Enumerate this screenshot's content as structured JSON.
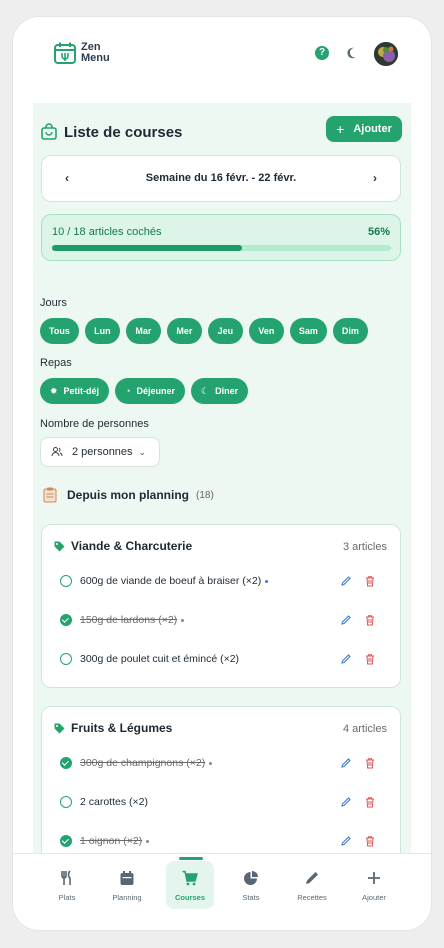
{
  "app": {
    "logo_line1": "Zen",
    "logo_line2": "Menu",
    "help_label": "?"
  },
  "header": {
    "title": "Liste de courses",
    "add_button": "Ajouter",
    "add_symbol": "+"
  },
  "week": {
    "label": "Semaine du 16 févr. - 22 févr.",
    "prev": "‹",
    "next": "›"
  },
  "progress": {
    "label": "10 / 18 articles cochés",
    "percent_label": "56%",
    "fraction": 0.56
  },
  "days": {
    "label": "Jours",
    "items": [
      "Tous",
      "Lun",
      "Mar",
      "Mer",
      "Jeu",
      "Ven",
      "Sam",
      "Dim"
    ]
  },
  "meals": {
    "label": "Repas",
    "items": [
      {
        "label": "Petit-déj",
        "icon": "sun-icon"
      },
      {
        "label": "Déjeuner",
        "icon": "clock-icon"
      },
      {
        "label": "Dîner",
        "icon": "moon-icon"
      }
    ]
  },
  "persons": {
    "label": "Nombre de personnes",
    "value": "2 personnes"
  },
  "planning": {
    "title": "Depuis mon planning",
    "count": "(18)"
  },
  "categories": [
    {
      "title": "Viande & Charcuterie",
      "count": "3 articles",
      "items": [
        {
          "text": "600g de viande de boeuf à braiser (×2)",
          "checked": false,
          "dot": "blue"
        },
        {
          "text": "150g de lardons (×2)",
          "checked": true,
          "dot": "grey"
        },
        {
          "text": "300g de poulet cuit et émincé (×2)",
          "checked": false,
          "dot": ""
        }
      ]
    },
    {
      "title": "Fruits & Légumes",
      "count": "4 articles",
      "items": [
        {
          "text": "300g de champignons (×2)",
          "checked": true,
          "dot": "grey"
        },
        {
          "text": "2 carottes (×2)",
          "checked": false,
          "dot": ""
        },
        {
          "text": "1 oignon (×2)",
          "checked": true,
          "dot": "grey"
        }
      ]
    }
  ],
  "nav": [
    {
      "label": "Plats",
      "icon": "utensils-icon",
      "active": false
    },
    {
      "label": "Planning",
      "icon": "calendar-icon",
      "active": false
    },
    {
      "label": "Courses",
      "icon": "cart-icon",
      "active": true
    },
    {
      "label": "Stats",
      "icon": "pie-chart-icon",
      "active": false
    },
    {
      "label": "Recettes",
      "icon": "pencil-icon",
      "active": false
    },
    {
      "label": "Ajouter",
      "icon": "plus-icon",
      "active": false
    }
  ],
  "colors": {
    "accent": "#24a36f",
    "background": "#eef8f2",
    "delete": "#e05252",
    "edit": "#3a7bd5"
  }
}
